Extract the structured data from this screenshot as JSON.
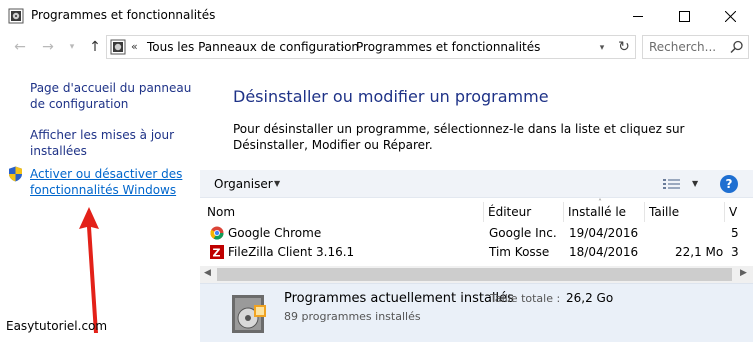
{
  "window": {
    "title": "Programmes et fonctionnalités",
    "controls": [
      "minimize-icon",
      "maximize-icon",
      "close-icon"
    ]
  },
  "address": {
    "overflow": "«",
    "crumbs": [
      "Tous les Panneaux de configuration",
      "Programmes et fonctionnalités"
    ],
    "separator": "›"
  },
  "search": {
    "placeholder": "Recherch..."
  },
  "sidebar": {
    "links": [
      {
        "label": "Page d'accueil du panneau de configuration"
      },
      {
        "label": "Afficher les mises à jour installées"
      },
      {
        "label": "Activer ou désactiver des fonctionnalités Windows",
        "icon": "shield-icon"
      }
    ],
    "watermark": "Easytutoriel.com"
  },
  "main": {
    "title": "Désinstaller ou modifier un programme",
    "description": "Pour désinstaller un programme, sélectionnez-le dans la liste et cliquez sur Désinstaller, Modifier ou Réparer."
  },
  "toolbar": {
    "organize_label": "Organiser",
    "help_label": "?"
  },
  "table": {
    "columns": [
      "Nom",
      "Éditeur",
      "Installé le",
      "Taille",
      "V"
    ],
    "rows": [
      {
        "icon": "chrome-icon",
        "name": "Google Chrome",
        "publisher": "Google Inc.",
        "installed": "19/04/2016",
        "size": "",
        "version": "5"
      },
      {
        "icon": "filezilla-icon",
        "name": "FileZilla Client 3.16.1",
        "publisher": "Tim Kosse",
        "installed": "18/04/2016",
        "size": "22,1 Mo",
        "version": "3"
      }
    ]
  },
  "details": {
    "title": "Programmes actuellement installés",
    "size_label": "Taille totale :",
    "size_value": "26,2 Go",
    "count": "89 programmes installés"
  },
  "colors": {
    "link": "#1e3287",
    "accent_link": "#0066cc",
    "details_bg": "#eaf0f8",
    "toolbar_bg": "#f0f3f8",
    "arrow": "#e32119"
  }
}
